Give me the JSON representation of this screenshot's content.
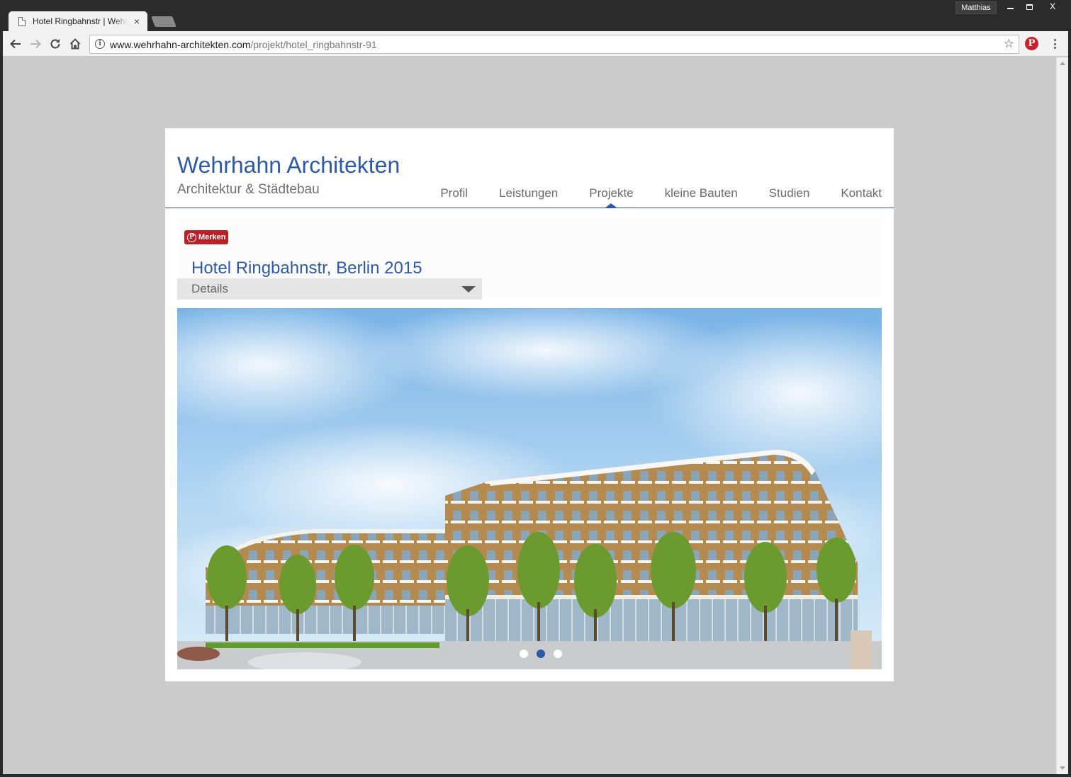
{
  "browser": {
    "tab_title": "Hotel Ringbahnstr | Wehrhahn Architekten",
    "tab_close": "×",
    "profile_name": "Matthias",
    "close_symbol": "X",
    "url_host": "www.wehrhahn-architekten.com",
    "url_path": "/projekt/hotel_ringbahnstr-91",
    "info_symbol": "i",
    "star_symbol": "☆",
    "pinterest_symbol": "P",
    "icons": {
      "back": "arrow-left-icon",
      "forward": "arrow-right-icon",
      "reload": "reload-icon",
      "home": "home-icon",
      "info": "info-icon",
      "bookmark": "star-icon",
      "extension": "pinterest-icon",
      "menu": "kebab-menu-icon"
    }
  },
  "site": {
    "title": "Wehrhahn Architekten",
    "subtitle": "Architektur & Städtebau",
    "nav": [
      "Profil",
      "Leistungen",
      "Projekte",
      "kleine Bauten",
      "Studien",
      "Kontakt"
    ],
    "active_nav": "Projekte",
    "accent_color": "#2c5aa8"
  },
  "project": {
    "pin_button_label": "Merken",
    "pin_symbol": "P",
    "title": "Hotel Ringbahnstr, Berlin 2015",
    "details_label": "Details",
    "slider": {
      "slide_count": 3,
      "active_slide": 2
    }
  }
}
